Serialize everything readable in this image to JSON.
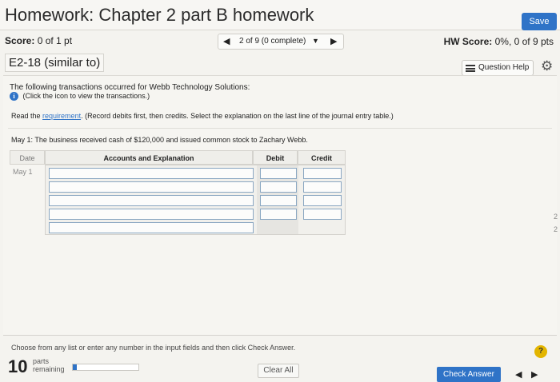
{
  "header": {
    "title": "Homework: Chapter 2 part B homework",
    "save_label": "Save"
  },
  "score_row": {
    "score_label": "Score:",
    "score_value": "0 of 1 pt",
    "question_nav": "2 of 9 (0 complete)",
    "hw_score_label": "HW Score:",
    "hw_score_value": "0%, 0 of 9 pts"
  },
  "question": {
    "id": "E2-18 (similar to)",
    "help_label": "Question Help"
  },
  "content": {
    "intro": "The following transactions occurred for Webb Technology Solutions:",
    "info_text": "(Click the icon to view the transactions.)",
    "read_prefix": "Read the",
    "requirement_link": "requirement",
    "read_suffix": ". (Record debits first, then credits. Select the explanation on the last line of the journal entry table.)",
    "transaction": "May 1: The business received cash of $120,000 and issued common stock to Zachary Webb."
  },
  "journal": {
    "headers": [
      "Date",
      "Accounts and Explanation",
      "Debit",
      "Credit"
    ],
    "date": "May 1",
    "rows": 5
  },
  "side_marks": [
    "2",
    "2"
  ],
  "footer": {
    "instruction": "Choose from any list or enter any number in the input fields and then click Check Answer.",
    "help_icon": "?",
    "parts_count": "10",
    "parts_label_1": "parts",
    "parts_label_2": "remaining",
    "progress_fraction": 0.06,
    "clear_label": "Clear All",
    "check_label": "Check Answer"
  },
  "colors": {
    "accent": "#2f73c7",
    "help": "#e3b500"
  }
}
